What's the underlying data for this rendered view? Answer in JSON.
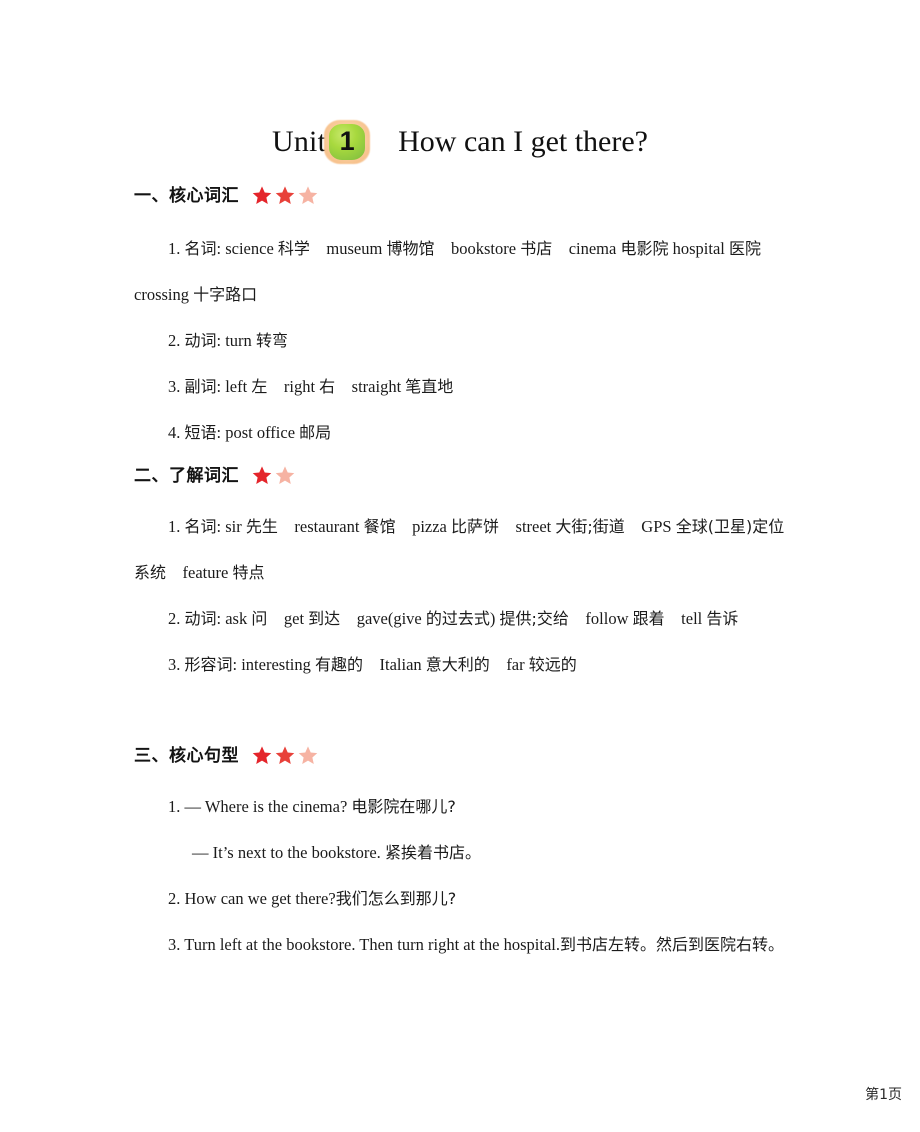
{
  "document": {
    "title": {
      "prefix": "Unit",
      "badge_number": "1",
      "heading": "How can I get there?"
    },
    "footer": "第1页",
    "colors": {
      "star_solid_1": "#e4252b",
      "star_solid_2": "#e8413a",
      "star_faded": "#f6b3a3",
      "badge_green": "#8cc63f",
      "badge_halo": "#f7c18c",
      "text": "#1b1b1b"
    }
  },
  "sections": [
    {
      "label": "一、核心词汇",
      "stars": [
        "solid",
        "solid",
        "faded"
      ],
      "lines": [
        {
          "indent": "first",
          "parts": [
            {
              "t": "1. ",
              "cjk": false
            },
            {
              "t": "名词",
              "cjk": true
            },
            {
              "t": ": science ",
              "cjk": false
            },
            {
              "t": "科学",
              "cjk": true
            },
            {
              "t": "　museum ",
              "cjk": false
            },
            {
              "t": "博物馆",
              "cjk": true
            },
            {
              "t": "　bookstore ",
              "cjk": false
            },
            {
              "t": "书店",
              "cjk": true
            },
            {
              "t": "　cinema ",
              "cjk": false
            },
            {
              "t": "电影院",
              "cjk": true
            },
            {
              "t": " hospital ",
              "cjk": false
            },
            {
              "t": "医院",
              "cjk": true
            },
            {
              "t": "　crossing ",
              "cjk": false
            },
            {
              "t": "十字路口",
              "cjk": true
            }
          ]
        },
        {
          "indent": "first",
          "parts": [
            {
              "t": "2. ",
              "cjk": false
            },
            {
              "t": "动词",
              "cjk": true
            },
            {
              "t": ": turn ",
              "cjk": false
            },
            {
              "t": "转弯",
              "cjk": true
            }
          ]
        },
        {
          "indent": "first",
          "parts": [
            {
              "t": "3. ",
              "cjk": false
            },
            {
              "t": "副词",
              "cjk": true
            },
            {
              "t": ": left ",
              "cjk": false
            },
            {
              "t": "左",
              "cjk": true
            },
            {
              "t": "　right ",
              "cjk": false
            },
            {
              "t": "右",
              "cjk": true
            },
            {
              "t": "　straight ",
              "cjk": false
            },
            {
              "t": "笔直地",
              "cjk": true
            }
          ]
        },
        {
          "indent": "first",
          "parts": [
            {
              "t": "4. ",
              "cjk": false
            },
            {
              "t": "短语",
              "cjk": true
            },
            {
              "t": ": post office ",
              "cjk": false
            },
            {
              "t": "邮局",
              "cjk": true
            }
          ]
        }
      ]
    },
    {
      "label": "二、了解词汇",
      "stars": [
        "solid",
        "faded"
      ],
      "lines": [
        {
          "indent": "first",
          "parts": [
            {
              "t": "1. ",
              "cjk": false
            },
            {
              "t": "名词",
              "cjk": true
            },
            {
              "t": ": sir ",
              "cjk": false
            },
            {
              "t": "先生",
              "cjk": true
            },
            {
              "t": "　restaurant ",
              "cjk": false
            },
            {
              "t": "餐馆",
              "cjk": true
            },
            {
              "t": "　pizza ",
              "cjk": false
            },
            {
              "t": "比萨饼",
              "cjk": true
            },
            {
              "t": "　street ",
              "cjk": false
            },
            {
              "t": "大街;街道",
              "cjk": true
            },
            {
              "t": "　GPS ",
              "cjk": false
            },
            {
              "t": "全球(卫星)定位系统",
              "cjk": true
            },
            {
              "t": "　feature ",
              "cjk": false
            },
            {
              "t": "特点",
              "cjk": true
            }
          ]
        },
        {
          "indent": "first",
          "parts": [
            {
              "t": "2. ",
              "cjk": false
            },
            {
              "t": "动词",
              "cjk": true
            },
            {
              "t": ": ask ",
              "cjk": false
            },
            {
              "t": "问",
              "cjk": true
            },
            {
              "t": "　get ",
              "cjk": false
            },
            {
              "t": "到达",
              "cjk": true
            },
            {
              "t": "　gave(give ",
              "cjk": false
            },
            {
              "t": "的过去式",
              "cjk": true
            },
            {
              "t": ") ",
              "cjk": false
            },
            {
              "t": "提供;交给",
              "cjk": true
            },
            {
              "t": "　follow ",
              "cjk": false
            },
            {
              "t": "跟着",
              "cjk": true
            },
            {
              "t": "　tell ",
              "cjk": false
            },
            {
              "t": "告诉",
              "cjk": true
            }
          ]
        },
        {
          "indent": "first",
          "parts": [
            {
              "t": "3. ",
              "cjk": false
            },
            {
              "t": "形容词",
              "cjk": true
            },
            {
              "t": ": interesting ",
              "cjk": false
            },
            {
              "t": "有趣的",
              "cjk": true
            },
            {
              "t": "　Italian ",
              "cjk": false
            },
            {
              "t": "意大利的",
              "cjk": true
            },
            {
              "t": "　far ",
              "cjk": false
            },
            {
              "t": "较远的",
              "cjk": true
            }
          ]
        }
      ]
    },
    {
      "label": "三、核心句型",
      "stars": [
        "solid",
        "solid",
        "faded"
      ],
      "lines": [
        {
          "indent": "first",
          "parts": [
            {
              "t": "1. — Where is the cinema? ",
              "cjk": false
            },
            {
              "t": "电影院在哪儿?",
              "cjk": true
            }
          ]
        },
        {
          "indent": "sub",
          "parts": [
            {
              "t": "— It’s next to the bookstore. ",
              "cjk": false
            },
            {
              "t": "紧挨着书店。",
              "cjk": true
            }
          ]
        },
        {
          "indent": "first",
          "parts": [
            {
              "t": "2. How can we get there?",
              "cjk": false
            },
            {
              "t": "我们怎么到那儿?",
              "cjk": true
            }
          ]
        },
        {
          "indent": "first",
          "parts": [
            {
              "t": "3. Turn left at the bookstore. Then turn right at the hospital.",
              "cjk": false
            },
            {
              "t": "到书店左转。然后到医院右转。",
              "cjk": true
            }
          ]
        }
      ]
    }
  ]
}
